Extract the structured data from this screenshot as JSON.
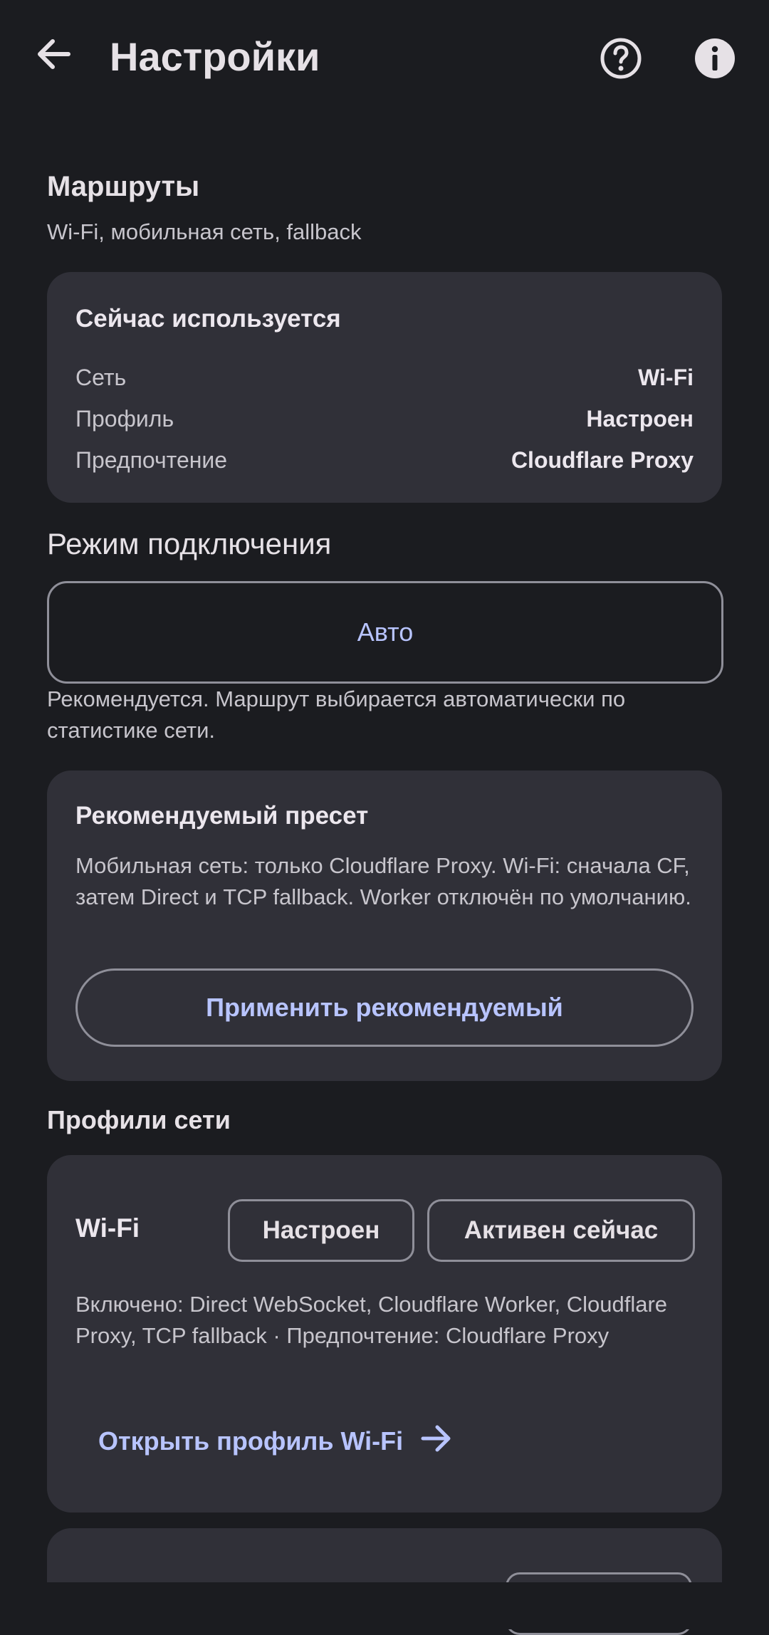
{
  "topbar": {
    "title": "Настройки",
    "back_icon": "arrow-back-icon",
    "help_icon": "help-circle-icon",
    "info_icon": "info-icon"
  },
  "routes": {
    "title": "Маршруты",
    "subtitle": "Wi-Fi, мобильная сеть, fallback"
  },
  "current": {
    "title": "Сейчас используется",
    "rows": [
      {
        "key": "Сеть",
        "value": "Wi-Fi"
      },
      {
        "key": "Профиль",
        "value": "Настроен"
      },
      {
        "key": "Предпочтение",
        "value": "Cloudflare Proxy"
      }
    ]
  },
  "mode": {
    "title": "Режим подключения",
    "selected": "Авто",
    "description": "Рекомендуется. Маршрут выбирается автоматически по статистике сети."
  },
  "preset": {
    "title": "Рекомендуемый пресет",
    "text": "Мобильная сеть: только Cloudflare Proxy. Wi-Fi: сначала CF, затем Direct и TCP fallback. Worker отключён по умолчанию.",
    "apply_label": "Применить рекомендуемый"
  },
  "profiles": {
    "title": "Профили сети",
    "wifi": {
      "name": "Wi-Fi",
      "status_chip": "Настроен",
      "active_chip": "Активен сейчас",
      "details": "Включено: Direct WebSocket, Cloudflare Worker, Cloudflare Proxy, TCP fallback · Предпочтение: Cloudflare Proxy",
      "open_label": "Открыть профиль Wi-Fi"
    }
  },
  "colors": {
    "background": "#1b1c20",
    "card": "#303038",
    "accent": "#b8c4ff",
    "outline": "#8f8f99"
  }
}
